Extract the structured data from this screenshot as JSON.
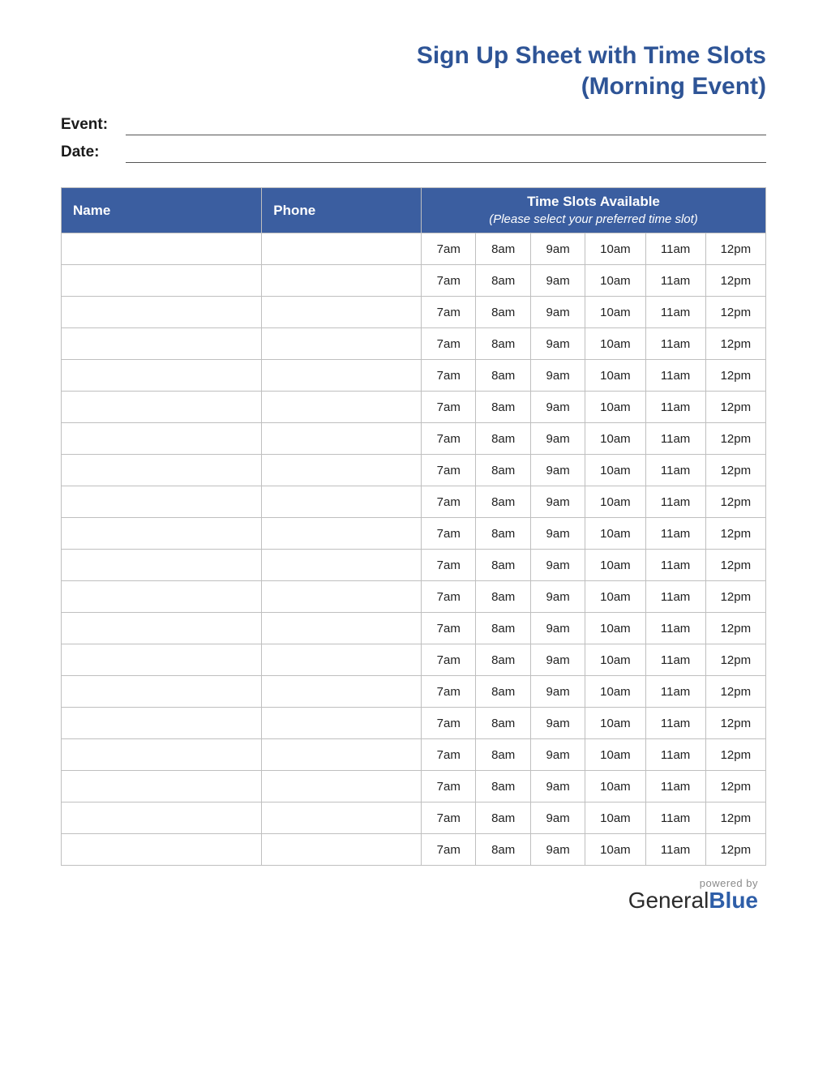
{
  "title_line1": "Sign Up Sheet with Time Slots",
  "title_line2": "(Morning Event)",
  "meta": {
    "event_label": "Event:",
    "event_value": "",
    "date_label": "Date:",
    "date_value": ""
  },
  "table": {
    "headers": {
      "name": "Name",
      "phone": "Phone",
      "timeslots_main": "Time Slots Available",
      "timeslots_sub": "(Please select your preferred time slot)"
    },
    "time_slots": [
      "7am",
      "8am",
      "9am",
      "10am",
      "11am",
      "12pm"
    ],
    "row_count": 20
  },
  "footer": {
    "powered_by": "powered by",
    "brand_a": "General",
    "brand_b": "Blue"
  }
}
